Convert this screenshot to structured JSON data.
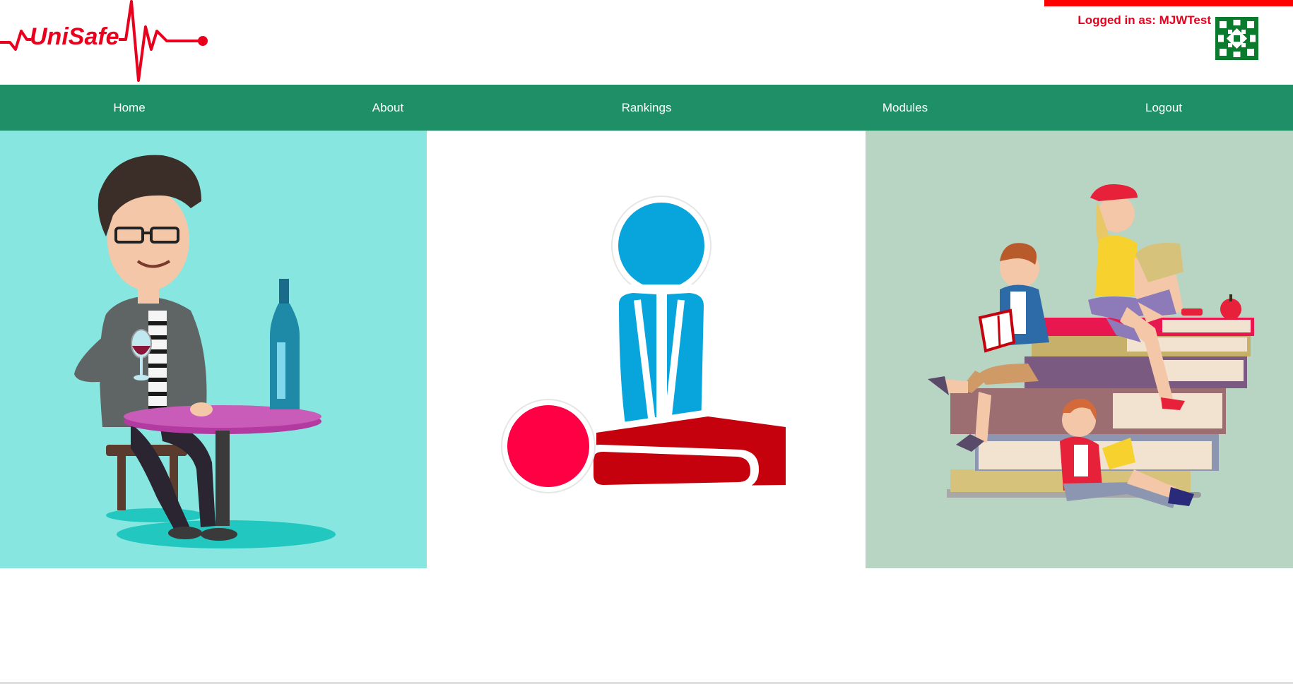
{
  "header": {
    "logo_text": "UniSafe",
    "login_label": "Logged in as: MJWTest",
    "avatar_icon": "identicon-avatar"
  },
  "nav": {
    "items": [
      {
        "label": "Home"
      },
      {
        "label": "About"
      },
      {
        "label": "Rankings"
      },
      {
        "label": "Modules"
      },
      {
        "label": "Logout"
      }
    ]
  },
  "panels": [
    {
      "icon": "man-drinking-wine-illustration"
    },
    {
      "icon": "cpr-first-aid-icon"
    },
    {
      "icon": "students-reading-books-illustration"
    }
  ],
  "colors": {
    "brand_red": "#e8001c",
    "nav_green": "#1f8f68",
    "accent_bar": "#ff0000"
  }
}
